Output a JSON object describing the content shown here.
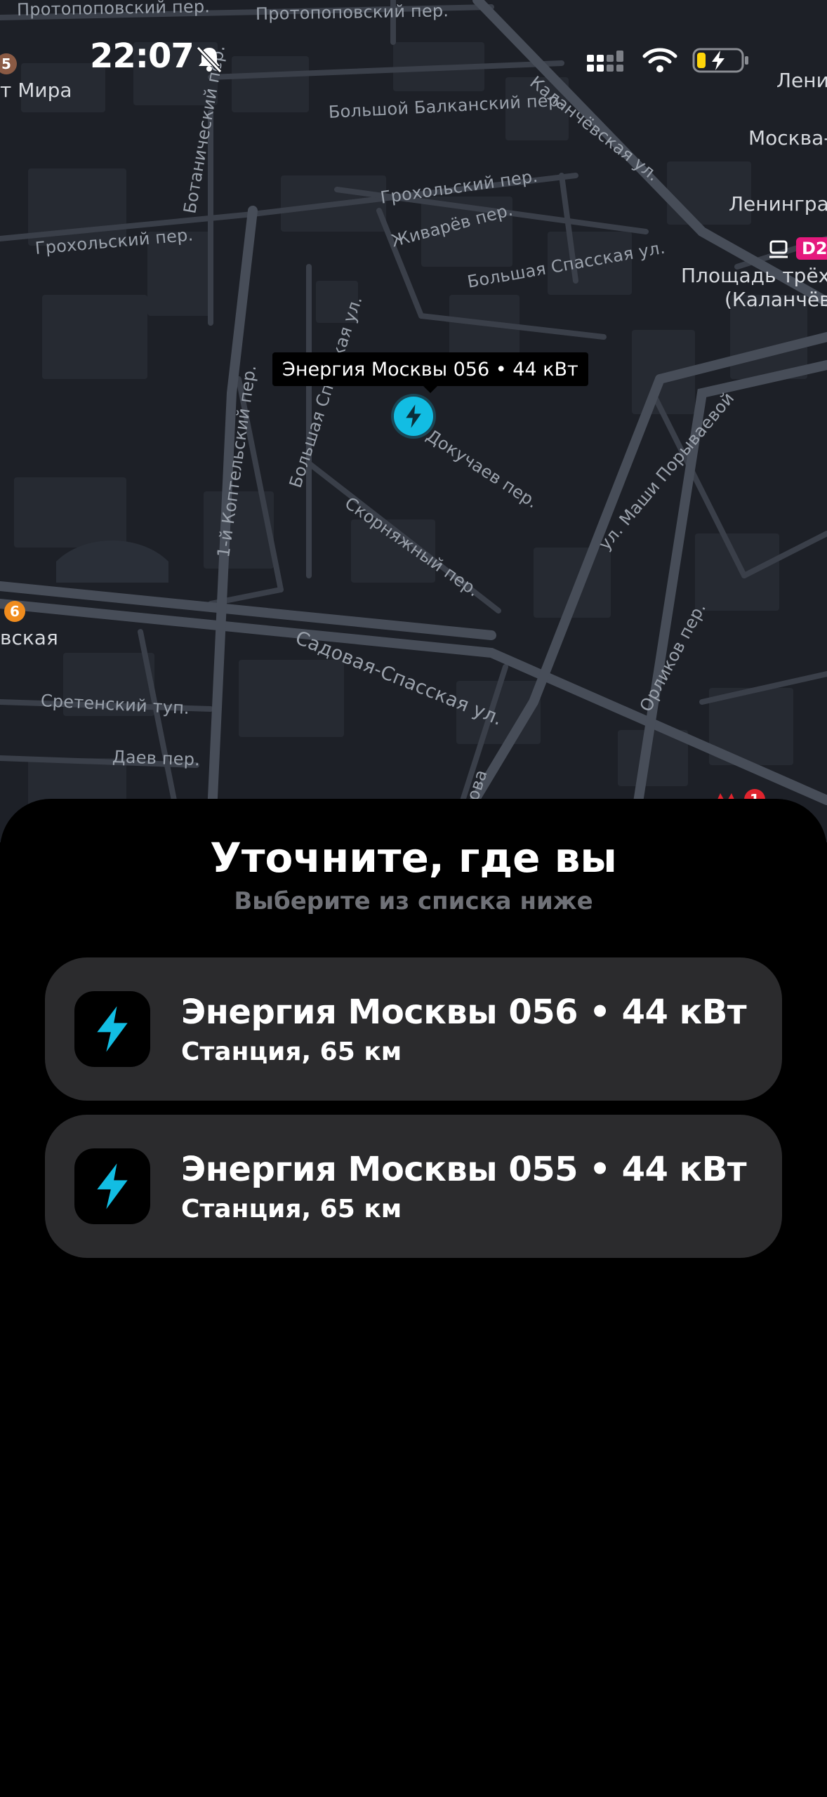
{
  "status_bar": {
    "time": "22:07",
    "icons": [
      "bell-slash-icon",
      "signal-icon",
      "wifi-icon",
      "battery-charging-icon"
    ]
  },
  "map": {
    "pin": {
      "label": "Энергия Москвы 056 • 44 кВт",
      "icon": "lightning-bolt-icon",
      "color": "#12bde3"
    },
    "streets": [
      "Протопоповский пер.",
      "Протопоповский пер.",
      "Большой Балканский пер.",
      "Каланчёвская ул.",
      "Ботанический пер.",
      "Грохольский пер.",
      "Грохольский пер.",
      "Живарёв пер.",
      "Большая Спасская ул.",
      "Большая Спасская ул.",
      "Докучаев пер.",
      "Скорняжный пер.",
      "1-й Коптельский пер.",
      "ул. Маши Порываевой",
      "Садовая-Спасская ул.",
      "Орликов пер.",
      "Сретенский туп.",
      "Даев пер.",
      "рова"
    ],
    "edge_labels": [
      "т Мира",
      "Лени",
      "Москва-",
      "Ленинград",
      "Площадь трёх",
      "(Каланчёв",
      "вская"
    ],
    "metro_badges": [
      "5",
      "6",
      "1"
    ],
    "rail_badge": "D2",
    "colors": {
      "background": "#1d2027",
      "metro_line_5": "#8a5a44",
      "metro_line_6": "#f08c1e",
      "metro_line_1": "#e0242e",
      "d2": "#e5197d"
    }
  },
  "sheet": {
    "title": "Уточните, где вы",
    "subtitle": "Выберите из списка ниже",
    "stations": [
      {
        "name": "Энергия Москвы 056 • 44 кВт",
        "meta": "Станция, 65 км",
        "icon": "lightning-bolt-icon"
      },
      {
        "name": "Энергия Москвы 055 • 44 кВт",
        "meta": "Станция, 65 км",
        "icon": "lightning-bolt-icon"
      }
    ],
    "accent_color": "#12bde3"
  }
}
